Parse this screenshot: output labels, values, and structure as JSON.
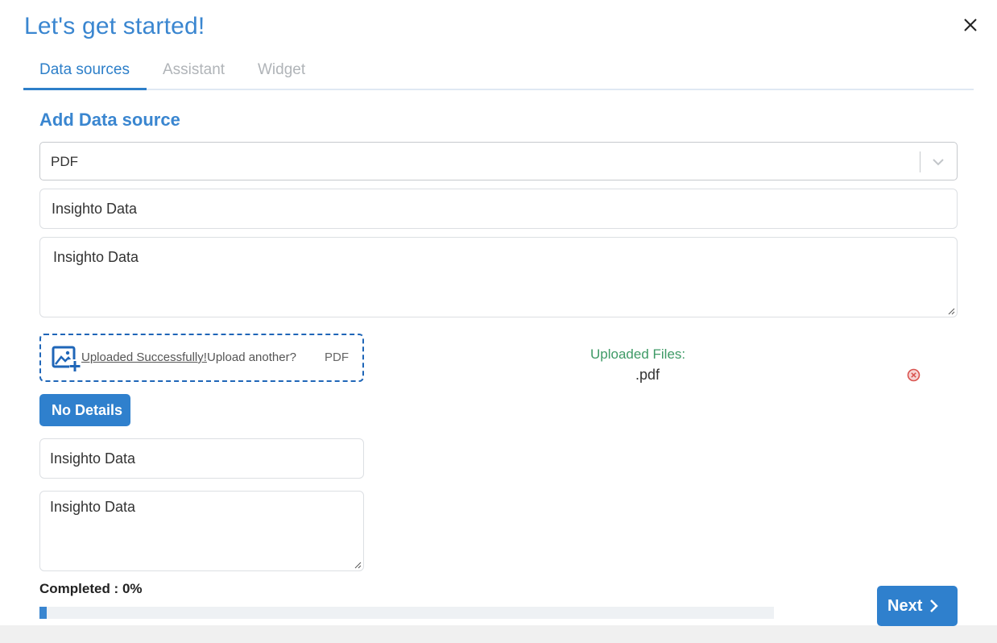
{
  "header": {
    "title": "Let's get started!"
  },
  "tabs": [
    {
      "label": "Data sources",
      "active": true
    },
    {
      "label": "Assistant",
      "active": false
    },
    {
      "label": "Widget",
      "active": false
    }
  ],
  "form": {
    "section_title": "Add Data source",
    "source_type": "PDF",
    "name_value": "Insighto Data",
    "description_value": "Insighto Data",
    "upload": {
      "success_link": "Uploaded Successfully!",
      "again_text": "Upload another?",
      "file_type": "PDF"
    },
    "uploaded_files_label": "Uploaded Files:",
    "uploaded_files": [
      ".pdf"
    ],
    "details_button": "No Details",
    "detail_name_value": "Insighto Data",
    "detail_description_value": "Insighto Data"
  },
  "footer": {
    "progress_label": "Completed : 0%",
    "progress_fraction": 0.01,
    "next_button": "Next"
  },
  "colors": {
    "accent": "#2f80cd",
    "success": "#3e9a66",
    "danger": "#d9534f"
  }
}
